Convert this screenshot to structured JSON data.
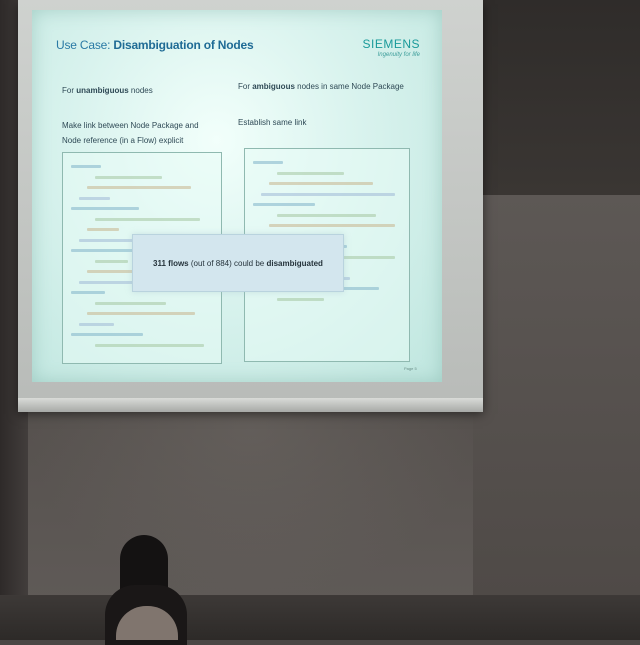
{
  "slide": {
    "title_prefix": "Use Case:",
    "title_bold": "Disambiguation of Nodes",
    "logo": "SIEMENS",
    "logo_tagline": "Ingenuity for life",
    "left_heading_prefix": "For",
    "left_heading_bold": "unambiguous",
    "left_heading_suffix": "nodes",
    "right_heading_prefix": "For",
    "right_heading_bold": "ambiguous",
    "right_heading_suffix": "nodes in same Node Package",
    "left_description_line1": "Make link between Node Package and",
    "left_description_line2": "Node reference (in a Flow) explicit",
    "right_description": "Establish same link",
    "callout_prefix": "311 flows",
    "callout_middle": "(out of 884) could be",
    "callout_bold": "disambiguated",
    "footer_left": "",
    "footer_right": "Page 5"
  },
  "colors": {
    "slide_title": "#2a7aa5",
    "logo": "#1a9a9a",
    "slide_background": "#d9f3ee",
    "callout_background": "#d3e6ee"
  }
}
